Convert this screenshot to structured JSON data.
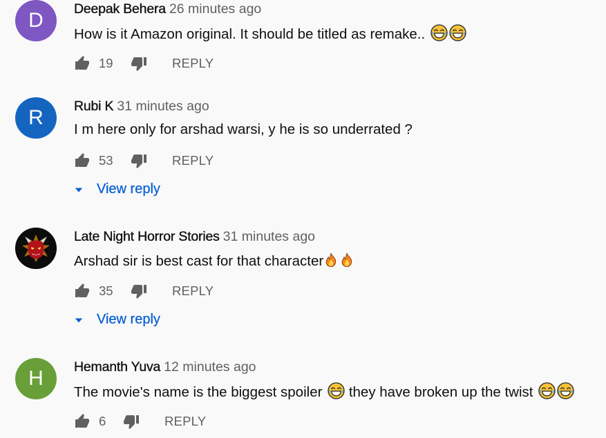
{
  "comments": [
    {
      "author": "Deepak Behera",
      "time": "26 minutes ago",
      "avatar_letter": "D",
      "avatar_color": "#7e57c2",
      "text": "How is it Amazon original. It should be titled as remake..",
      "trailing_emoji": [
        "laughing-face",
        "laughing-face"
      ],
      "likes": "19",
      "reply_label": "REPLY"
    },
    {
      "author": "Rubi K",
      "time": "31 minutes ago",
      "avatar_letter": "R",
      "avatar_color": "#1565c0",
      "text": "I m here only for arshad warsi, y he is so underrated ?",
      "likes": "53",
      "reply_label": "REPLY",
      "view_replies_label": "View reply"
    },
    {
      "author": "Late Night Horror Stories",
      "time": "31 minutes ago",
      "avatar_icon": "devil-mask-icon",
      "text": "Arshad sir is best cast for that character",
      "trailing_emoji": [
        "fire",
        "fire"
      ],
      "likes": "35",
      "reply_label": "REPLY",
      "view_replies_label": "View reply"
    },
    {
      "author": "Hemanth Yuva",
      "time": "12 minutes ago",
      "avatar_letter": "H",
      "avatar_color": "#689f38",
      "text_part1": "The movie's name is the biggest spoiler",
      "text_part2": "they have broken up the twist",
      "emoji_after_part1": [
        "laughing-face"
      ],
      "trailing_emoji": [
        "laughing-face",
        "laughing-face"
      ],
      "likes": "6",
      "reply_label": "REPLY"
    }
  ],
  "colors": {
    "background": "#f9f9f9",
    "text_primary": "#0f0f0f",
    "text_secondary": "#606060",
    "link_blue": "#065fd4"
  }
}
